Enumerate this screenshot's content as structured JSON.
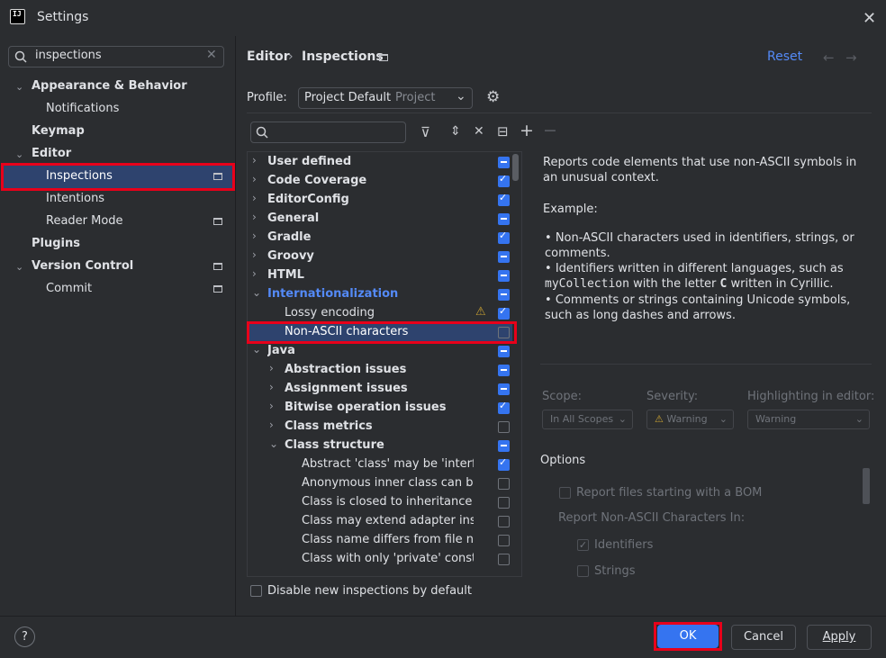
{
  "window": {
    "title": "Settings"
  },
  "search": {
    "value": "inspections"
  },
  "sidebar": {
    "items": [
      {
        "label": "Appearance & Behavior"
      },
      {
        "label": "Notifications"
      },
      {
        "label": "Keymap"
      },
      {
        "label": "Editor"
      },
      {
        "label": "Inspections"
      },
      {
        "label": "Intentions"
      },
      {
        "label": "Reader Mode"
      },
      {
        "label": "Plugins"
      },
      {
        "label": "Version Control"
      },
      {
        "label": "Commit"
      }
    ]
  },
  "header": {
    "breadcrumb": [
      "Editor",
      "Inspections"
    ],
    "reset": "Reset",
    "profile_label": "Profile:",
    "profile_value": "Project Default",
    "profile_hint": "Project"
  },
  "tree": {
    "rows": [
      {
        "label": "User defined"
      },
      {
        "label": "Code Coverage"
      },
      {
        "label": "EditorConfig"
      },
      {
        "label": "General"
      },
      {
        "label": "Gradle"
      },
      {
        "label": "Groovy"
      },
      {
        "label": "HTML"
      },
      {
        "label": "Internationalization"
      },
      {
        "label": "Lossy encoding"
      },
      {
        "label": "Non-ASCII characters"
      },
      {
        "label": "Java"
      },
      {
        "label": "Abstraction issues"
      },
      {
        "label": "Assignment issues"
      },
      {
        "label": "Bitwise operation issues"
      },
      {
        "label": "Class metrics"
      },
      {
        "label": "Class structure"
      },
      {
        "label": "Abstract 'class' may be 'interfa"
      },
      {
        "label": "Anonymous inner class can be"
      },
      {
        "label": "Class is closed to inheritance"
      },
      {
        "label": "Class may extend adapter inst"
      },
      {
        "label": "Class name differs from file na"
      },
      {
        "label": "Class with only 'private' constr"
      }
    ]
  },
  "description": {
    "intro": "Reports code elements that use non-ASCII symbols in an unusual context.",
    "example_heading": "Example:",
    "b1": "Non-ASCII characters used in identifiers, strings, or comments.",
    "b2_pre": "Identifiers written in different languages, such as",
    "b2_code": "myCollection",
    "b2_mid": "with the letter",
    "b2_letter": "C",
    "b2_post": "written in Cyrillic.",
    "b3": "Comments or strings containing Unicode symbols, such as long dashes and arrows."
  },
  "settings": {
    "scope_label": "Scope:",
    "scope_value": "In All Scopes",
    "severity_label": "Severity:",
    "severity_value": "Warning",
    "highlight_label": "Highlighting in editor:",
    "highlight_value": "Warning",
    "options_label": "Options",
    "bom": "Report files starting with a BOM",
    "report_in": "Report Non-ASCII Characters In:",
    "identifiers": "Identifiers",
    "strings": "Strings"
  },
  "footer": {
    "disable_new": "Disable new inspections by default",
    "ok": "OK",
    "cancel": "Cancel",
    "apply": "Apply",
    "help": "?"
  },
  "colors": {
    "accent": "#3574f0",
    "highlight_frame": "#e8001a",
    "link": "#548af7"
  }
}
